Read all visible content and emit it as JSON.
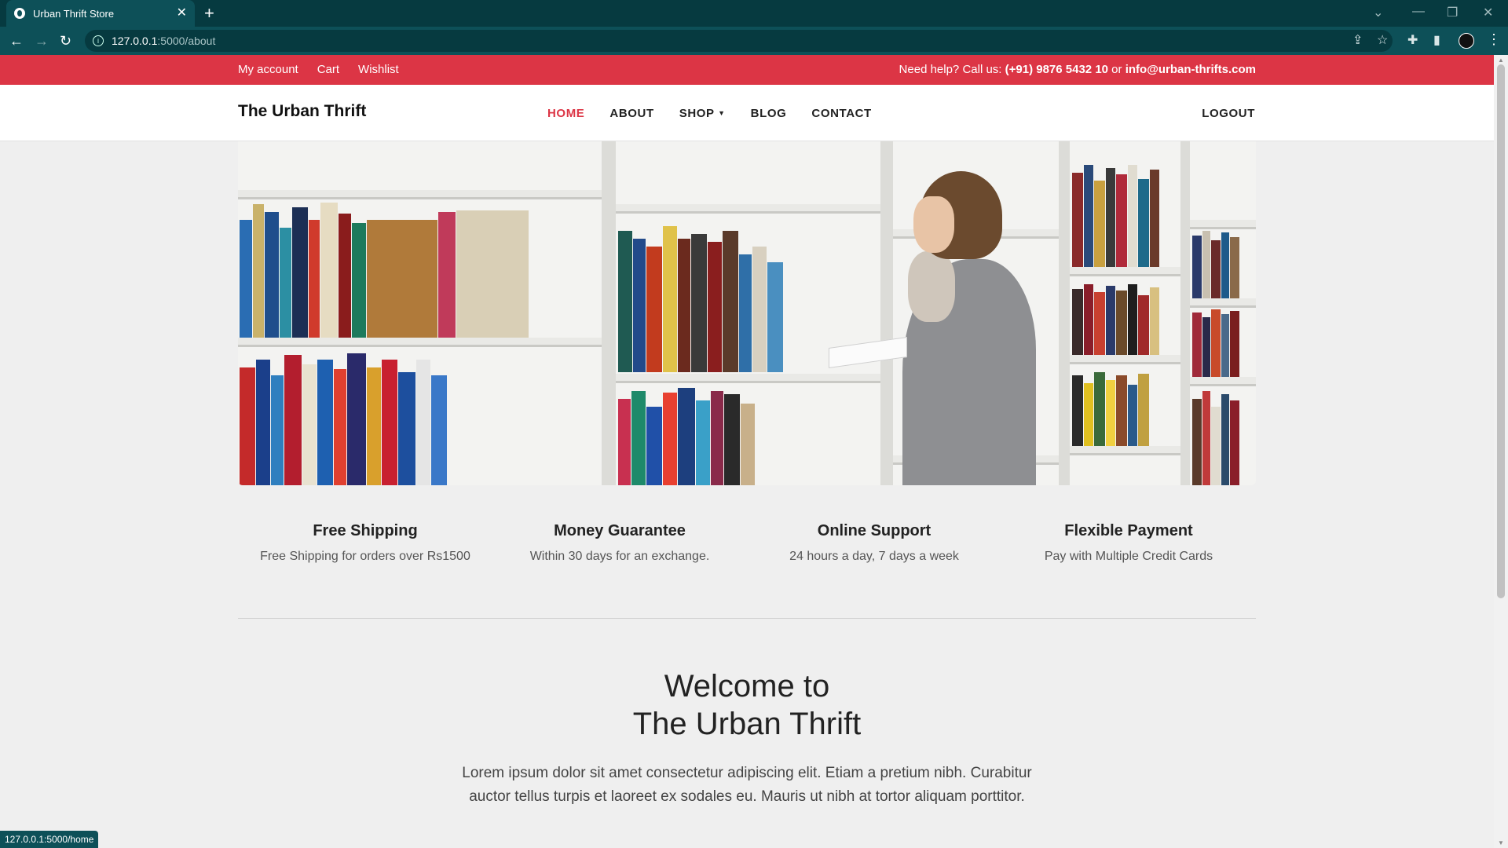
{
  "browser": {
    "tab_title": "Urban Thrift Store",
    "tab_close": "✕",
    "new_tab": "+",
    "url_host": "127.0.0.1",
    "url_path": ":5000/about",
    "status_url": "127.0.0.1:5000/home"
  },
  "topbar": {
    "links": [
      "My account",
      "Cart",
      "Wishlist"
    ],
    "help_prefix": "Need help? Call us: ",
    "phone": "(+91) 9876 5432 10",
    "or": " or ",
    "email": "info@urban-thrifts.com"
  },
  "nav": {
    "brand": "The Urban Thrift",
    "items": [
      {
        "label": "HOME",
        "active": true
      },
      {
        "label": "ABOUT",
        "active": false
      },
      {
        "label": "SHOP",
        "active": false
      },
      {
        "label": "BLOG",
        "active": false
      },
      {
        "label": "CONTACT",
        "active": false
      }
    ],
    "logout": "LOGOUT"
  },
  "features": [
    {
      "title": "Free Shipping",
      "text": "Free Shipping for orders over Rs1500"
    },
    {
      "title": "Money Guarantee",
      "text": "Within 30 days for an exchange."
    },
    {
      "title": "Online Support",
      "text": "24 hours a day, 7 days a week"
    },
    {
      "title": "Flexible Payment",
      "text": "Pay with Multiple Credit Cards"
    }
  ],
  "welcome": {
    "line1": "Welcome to",
    "line2": "The Urban Thrift",
    "body": "Lorem ipsum dolor sit amet consectetur adipiscing elit. Etiam a pretium nibh. Curabitur auctor tellus turpis et laoreet ex sodales eu. Mauris ut nibh at tortor aliquam porttitor."
  },
  "colors": {
    "accent": "#dc3545",
    "browser_frame": "#063a40",
    "browser_toolbar": "#0d5058"
  }
}
